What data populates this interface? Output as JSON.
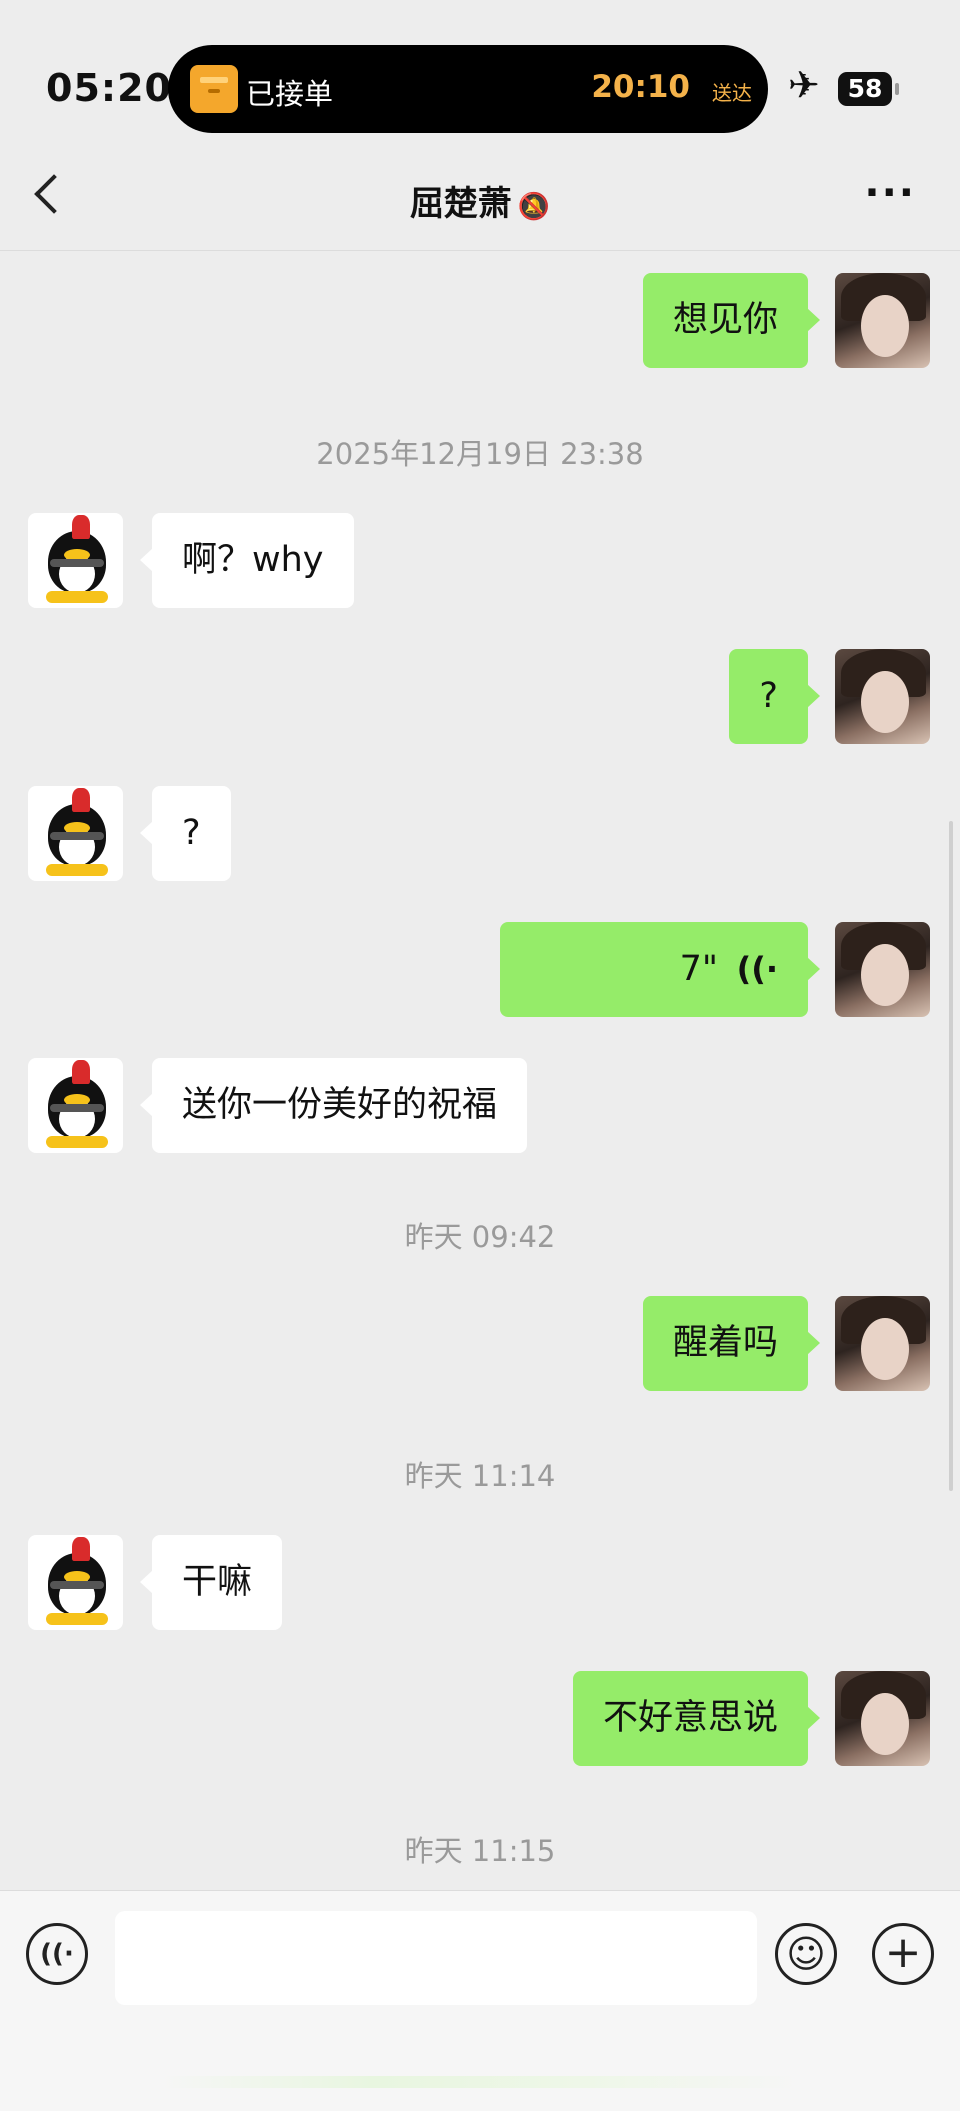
{
  "status_bar": {
    "time": "05:20",
    "island": {
      "label": "已接单",
      "time": "20:10",
      "sub": "送达"
    },
    "airplane_icon": "✈",
    "battery": "58"
  },
  "header": {
    "title": "屈楚萧",
    "mute_icon": "🔕",
    "more_icon": "···"
  },
  "messages": [
    {
      "side": "mine",
      "text": "想见你"
    },
    {
      "timestamp": "2025年12月19日 23:38"
    },
    {
      "side": "peer",
      "text": "啊？why"
    },
    {
      "side": "mine",
      "text": "?"
    },
    {
      "side": "peer",
      "text": "?"
    },
    {
      "side": "mine",
      "voice_duration": "7\"",
      "voice_icon": "((·"
    },
    {
      "side": "peer",
      "text": "送你一份美好的祝福"
    },
    {
      "timestamp": "昨天 09:42"
    },
    {
      "side": "mine",
      "text": "醒着吗"
    },
    {
      "timestamp": "昨天 11:14"
    },
    {
      "side": "peer",
      "text": "干嘛"
    },
    {
      "side": "mine",
      "text": "不好意思说"
    },
    {
      "timestamp": "昨天 11:15"
    }
  ],
  "input_bar": {
    "voice_icon": "((·",
    "emoji_icon": "☺",
    "plus_icon": "+"
  }
}
